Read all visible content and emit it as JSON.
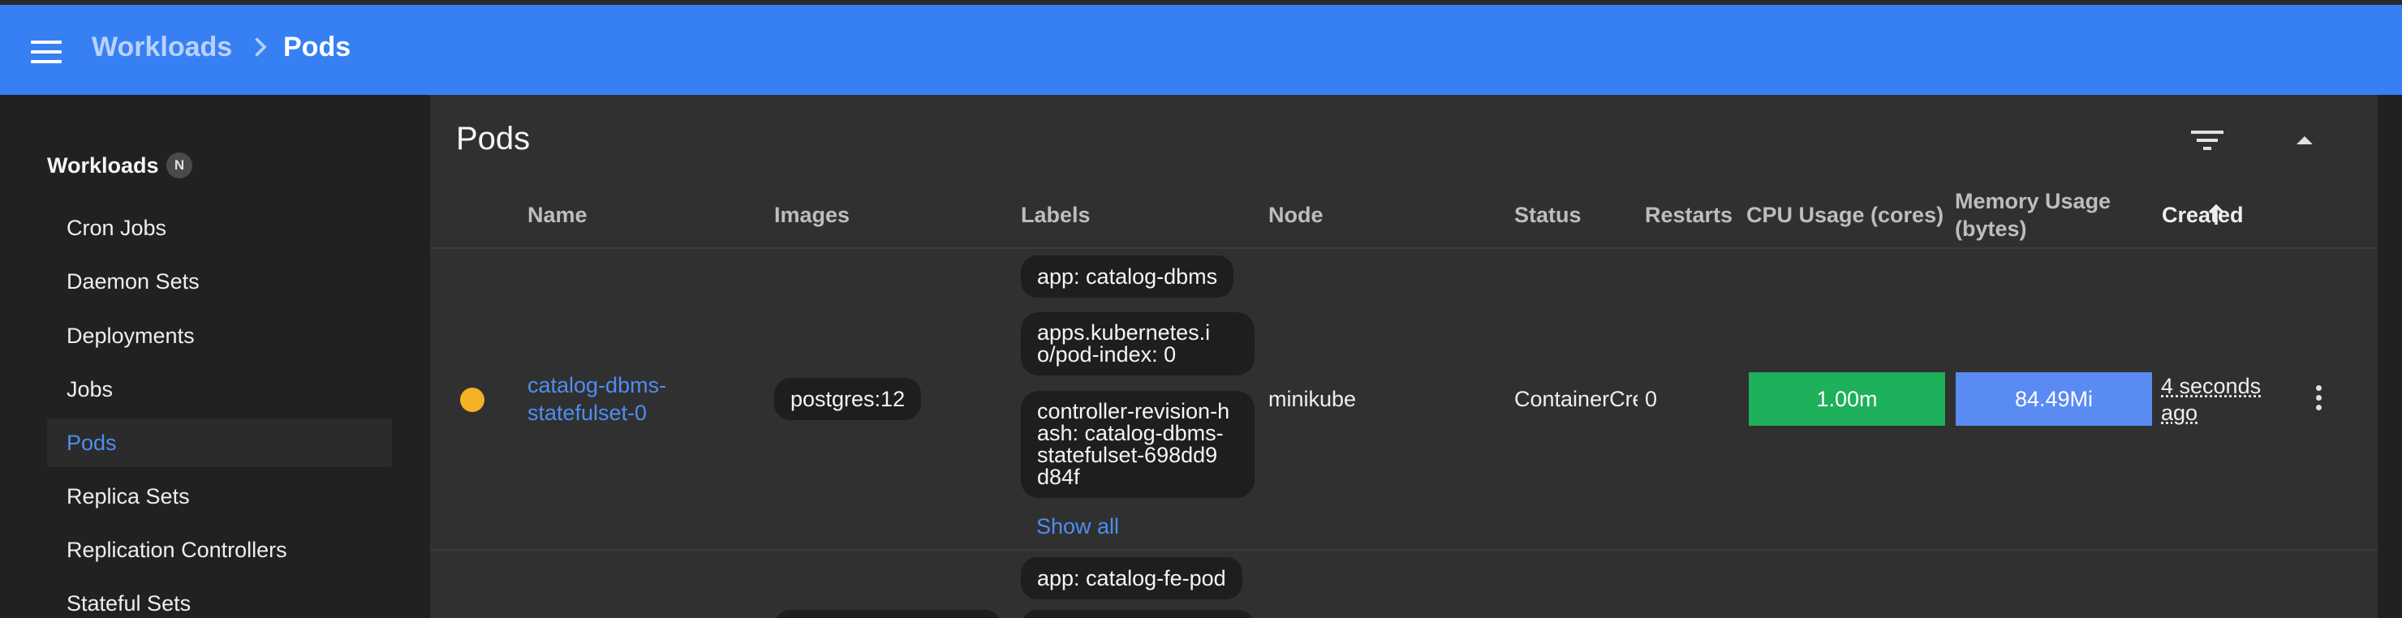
{
  "topbar": {
    "breadcrumb_parent": "Workloads",
    "breadcrumb_current": "Pods",
    "icons": {
      "menu": "hamburger-icon",
      "separator": "chevron-right-icon"
    }
  },
  "sidebar": {
    "section_title": "Workloads",
    "namespace_badge": "N",
    "items": [
      {
        "label": "Cron Jobs",
        "active": false
      },
      {
        "label": "Daemon Sets",
        "active": false
      },
      {
        "label": "Deployments",
        "active": false
      },
      {
        "label": "Jobs",
        "active": false
      },
      {
        "label": "Pods",
        "active": true
      },
      {
        "label": "Replica Sets",
        "active": false
      },
      {
        "label": "Replication Controllers",
        "active": false
      },
      {
        "label": "Stateful Sets",
        "active": false
      }
    ]
  },
  "card": {
    "title": "Pods",
    "icons": {
      "filter": "filter-icon",
      "collapse": "chevron-up-icon",
      "sort": "arrow-up-icon",
      "more": "more-vert-icon"
    }
  },
  "table": {
    "columns": {
      "name": "Name",
      "images": "Images",
      "labels": "Labels",
      "node": "Node",
      "status": "Status",
      "restarts": "Restarts",
      "cpu": "CPU Usage (cores)",
      "memory_line1": "Memory Usage",
      "memory_line2": "(bytes)",
      "created": "Created"
    },
    "rows": [
      {
        "status_color": "#f5b124",
        "name_line1": "catalog-dbms-",
        "name_line2": "statefulset-0",
        "image": "postgres:12",
        "labels": [
          "app: catalog-dbms",
          "apps.kubernetes.i\no/pod-index: 0",
          "controller-revision-h\nash: catalog-dbms-\nstatefulset-698dd9\nd84f"
        ],
        "show_all": "Show all",
        "node": "minikube",
        "status": "ContainerCreating",
        "restarts": "0",
        "cpu": "1.00m",
        "memory": "84.49Mi",
        "created_line1": "4 seconds",
        "created_line2": "ago"
      },
      {
        "labels_first": "app: catalog-fe-pod"
      }
    ]
  },
  "colors": {
    "topbar": "#3780f4",
    "sidebar_bg": "#212121",
    "main_bg": "#303030",
    "link": "#4d8ef0",
    "cpu_bar": "#1eb05a",
    "memory_bar": "#5a8bf3",
    "status_pending": "#f5b124"
  }
}
